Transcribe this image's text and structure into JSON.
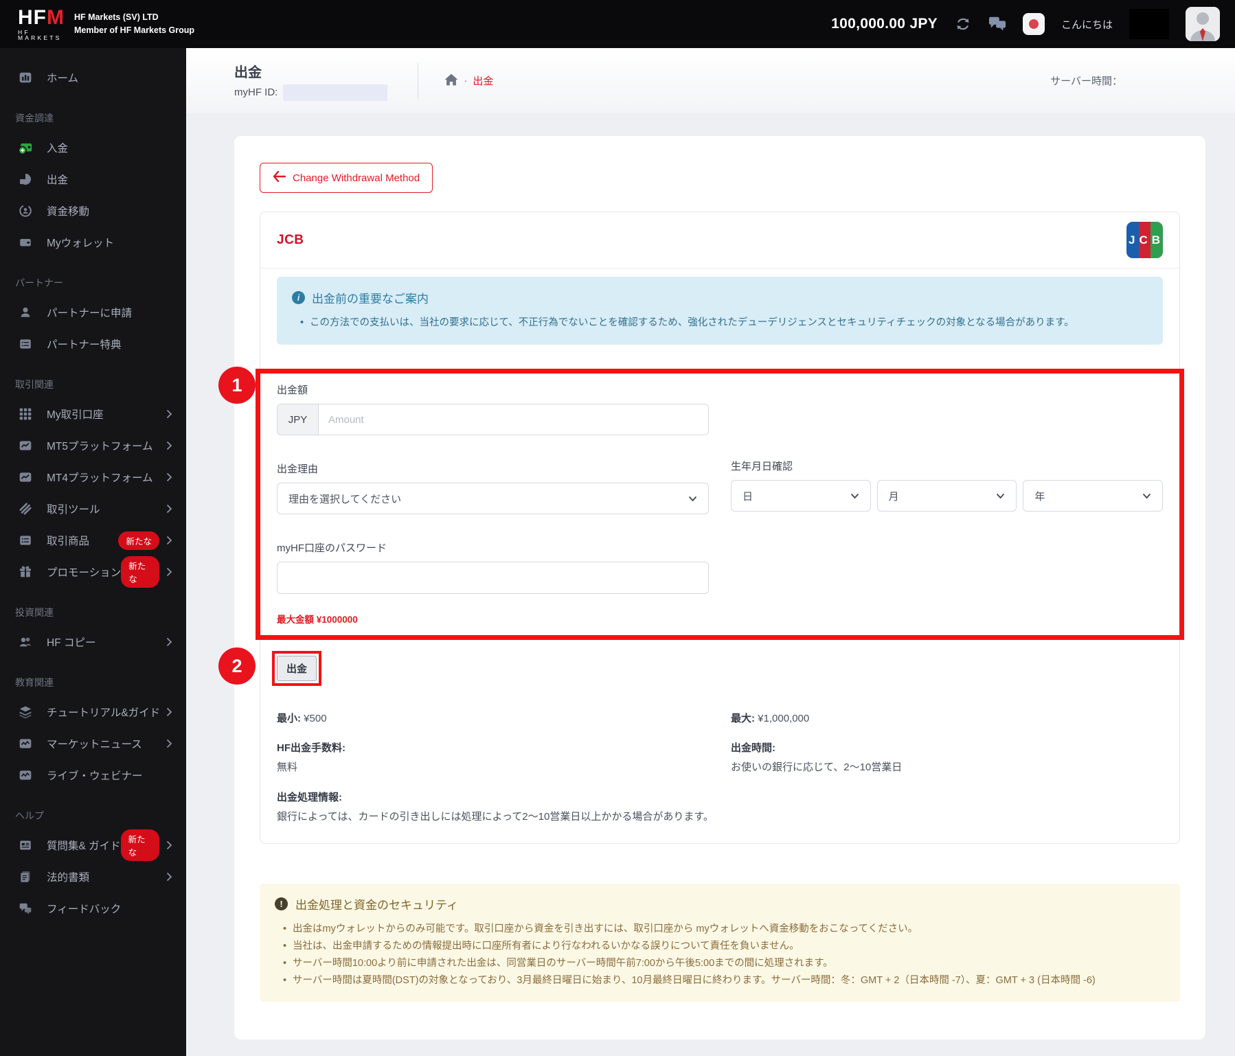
{
  "header": {
    "brand": "HFM",
    "brand_sub": "HF MARKETS",
    "company": "HF Markets (SV) LTD",
    "member": "Member of HF Markets Group",
    "balance": "100,000.00 JPY",
    "greeting": "こんにちは"
  },
  "sidebar": {
    "home": {
      "label": "ホーム"
    },
    "sections": [
      {
        "label": "資金調達",
        "items": [
          {
            "label": "入金"
          },
          {
            "label": "出金"
          },
          {
            "label": "資金移動"
          },
          {
            "label": "Myウォレット"
          }
        ]
      },
      {
        "label": "パートナー",
        "items": [
          {
            "label": "パートナーに申請"
          },
          {
            "label": "パートナー特典"
          }
        ]
      },
      {
        "label": "取引関連",
        "items": [
          {
            "label": "My取引口座"
          },
          {
            "label": "MT5プラットフォーム"
          },
          {
            "label": "MT4プラットフォーム"
          },
          {
            "label": "取引ツール"
          },
          {
            "label": "取引商品",
            "badge": "新たな"
          },
          {
            "label": "プロモーション",
            "badge": "新たな"
          }
        ]
      },
      {
        "label": "投資関連",
        "items": [
          {
            "label": "HF コピー"
          }
        ]
      },
      {
        "label": "教育関連",
        "items": [
          {
            "label": "チュートリアル&ガイド"
          },
          {
            "label": "マーケットニュース"
          },
          {
            "label": "ライブ・ウェビナー"
          }
        ]
      },
      {
        "label": "ヘルプ",
        "items": [
          {
            "label": "質問集& ガイド",
            "badge": "新たな"
          },
          {
            "label": "法的書類"
          },
          {
            "label": "フィードバック"
          }
        ]
      }
    ]
  },
  "page": {
    "title": "出金",
    "myhf_id_label": "myHF ID:",
    "breadcrumb_current": "出金",
    "server_time_label": "サーバー時間："
  },
  "content": {
    "change_method_label": "Change Withdrawal Method",
    "method_title": "JCB",
    "jcb_logo_text": "JCB",
    "info_box": {
      "title": "出金前の重要なご案内",
      "bullets": [
        "この方法での支払いは、当社の要求に応じて、不正行為でないことを確認するため、強化されたデューデリジェンスとセキュリティチェックの対象となる場合があります。"
      ]
    },
    "form": {
      "amount_label": "出金額",
      "currency": "JPY",
      "amount_placeholder": "Amount",
      "reason_label": "出金理由",
      "reason_value": "理由を選択してください",
      "dob_label": "生年月日確認",
      "dob_day": "日",
      "dob_month": "月",
      "dob_year": "年",
      "password_label": "myHF口座のパスワード",
      "max_amount_note": "最大金額 ¥1000000"
    },
    "submit_label": "出金",
    "limits": {
      "min_label": "最小:",
      "min_value": "¥500",
      "max_label": "最大:",
      "max_value": "¥1,000,000",
      "fee_label": "HF出金手数料:",
      "fee_value": "無料",
      "time_label": "出金時間:",
      "time_value": "お使いの銀行に応じて、2〜10営業日",
      "processing_label": "出金処理情報:",
      "processing_value": "銀行によっては、カードの引き出しには処理によって2〜10営業日以上かかる場合があります。"
    },
    "security_box": {
      "title": "出金処理と資金のセキュリティ",
      "bullets": [
        "出金はmyウォレットからのみ可能です。取引口座から資金を引き出すには、取引口座から myウォレットへ資金移動をおこなってください。",
        "当社は、出金申請するための情報提出時に口座所有者により行なわれるいかなる誤りについて責任を負いません。",
        "サーバー時間10:00より前に申請された出金は、同営業日のサーバー時間午前7:00から午後5:00までの間に処理されます。",
        "サーバー時間は夏時間(DST)の対象となっており、3月最終日曜日に始まり、10月最終日曜日に終わります。サーバー時間：冬：GMT + 2（日本時間 -7）、夏：GMT + 3 (日本時間 -6)"
      ]
    },
    "annotations": {
      "step1": "1",
      "step2": "2"
    }
  },
  "colors": {
    "accent_red": "#e11b22",
    "annotation_red": "#f31313",
    "badge_red": "#d40d18",
    "info_bg": "#d9edf7",
    "info_text": "#31708f",
    "warning_bg": "#fcf8e6",
    "warning_text": "#8a6d3b",
    "jcb_blue": "#1a5fae",
    "jcb_red": "#cf2331",
    "jcb_green": "#2f9e4f"
  }
}
